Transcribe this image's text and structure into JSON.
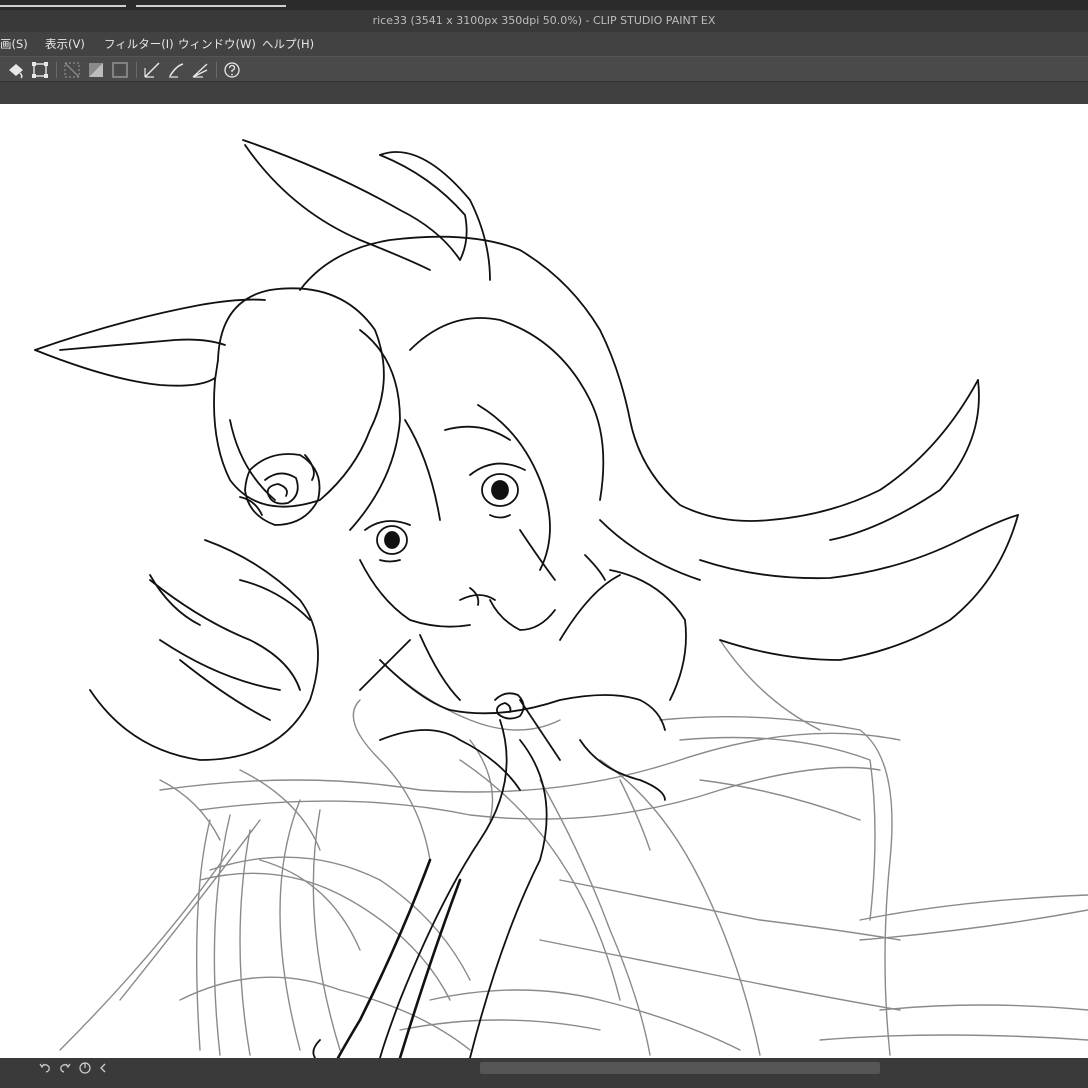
{
  "window": {
    "title": "rice33 (3541 x 3100px 350dpi 50.0%)  - CLIP STUDIO PAINT EX"
  },
  "menu": {
    "items": [
      {
        "label": "画(S)"
      },
      {
        "label": "表示(V)"
      },
      {
        "label": "フィルター(I)"
      },
      {
        "label": "ウィンドウ(W)"
      },
      {
        "label": "ヘルプ(H)"
      }
    ]
  },
  "toolbar": {
    "icons": [
      "fill-icon",
      "transform-icon",
      "selection-outside-icon",
      "selection-invert-icon",
      "selection-clear-icon",
      "ruler-icon",
      "brush-ruler-icon",
      "perspective-icon",
      "help-icon"
    ]
  },
  "statusbar": {
    "icons": [
      "undo-icon",
      "redo-icon",
      "rotate-icon",
      "collapse-icon"
    ]
  },
  "colors": {
    "ui_dark": "#3a3a3a",
    "menubar": "#424242",
    "toolbar": "#4a4a4a",
    "canvas": "#ffffff",
    "ink": "#111111",
    "sketch": "#8a8a8a"
  }
}
